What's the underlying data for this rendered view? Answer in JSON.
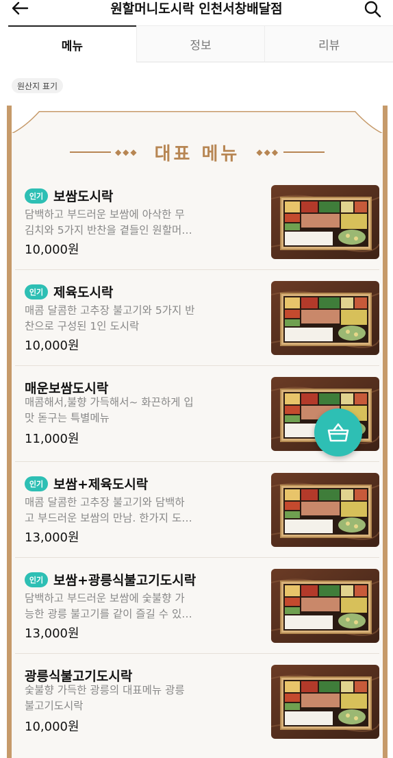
{
  "header": {
    "title": "원할머니도시락 인천서창배달점",
    "back_icon": "arrow-left-icon",
    "search_icon": "search-icon"
  },
  "tabs": [
    {
      "label": "메뉴",
      "active": true
    },
    {
      "label": "정보",
      "active": false
    },
    {
      "label": "리뷰",
      "active": false
    }
  ],
  "origin_chip": "원산지 표기",
  "featured": {
    "title": "대표 메뉴",
    "accent_color": "#c69a6a"
  },
  "menu_items": [
    {
      "name": "보쌈도시락",
      "popular_badge": "인기",
      "description": "담백하고 부드러운 보쌈에 아삭한 무김치와 5가지 반찬을 곁들인 원할머…",
      "desc_line1": "담백하고 부드러운 보쌈에 아삭한 무",
      "desc_line2": "김치와 5가지 반찬을 곁들인 원할머…",
      "price": "10,000원"
    },
    {
      "name": "제육도시락",
      "popular_badge": "인기",
      "desc_line1": "매콤 달콤한 고추장 불고기와 5가지 반",
      "desc_line2": "찬으로 구성된 1인 도시락",
      "price": "10,000원"
    },
    {
      "name": "매운보쌈도시락",
      "popular_badge": "",
      "desc_line1": "매콤해서,불향 가득해서~ 화끈하게 입",
      "desc_line2": "맛 돋구는 특별메뉴",
      "price": "11,000원"
    },
    {
      "name": "보쌈+제육도시락",
      "popular_badge": "인기",
      "desc_line1": "매콤 달콤한 고추장 불고기와 담백하",
      "desc_line2": "고 부드러운 보쌈의 만남. 한가지 도…",
      "price": "13,000원"
    },
    {
      "name": "보쌈+광릉식불고기도시락",
      "popular_badge": "인기",
      "desc_line1": "담백하고 부드러운 보쌈에 숯불향 가",
      "desc_line2": "능한 광릉 불고기를 같이 즐길 수 있…",
      "price": "13,000원"
    },
    {
      "name": "광릉식불고기도시락",
      "popular_badge": "",
      "desc_line1": "숯불향 가득한 광릉의 대표메뉴 광릉",
      "desc_line2": "불고기도시락",
      "price": "10,000원"
    }
  ],
  "cart_fab": {
    "icon": "basket-icon",
    "color": "#2ebfb4"
  }
}
